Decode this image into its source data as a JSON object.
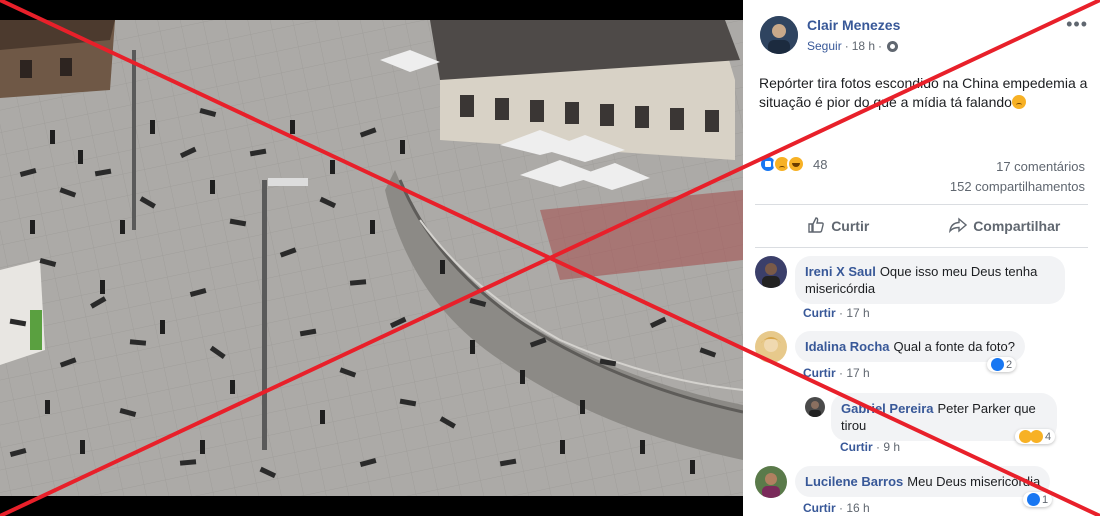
{
  "post": {
    "author": "Clair Menezes",
    "follow_label": "Seguir",
    "time": "18 h",
    "text": "Repórter tira fotos escondido na China empedemia a situação é pior do que a mídia tá falando",
    "reaction_count": "48",
    "comments_count": "17 comentários",
    "shares_count": "152 compartilhamentos",
    "like_label": "Curtir",
    "share_label": "Compartilhar"
  },
  "comments": [
    {
      "name": "Ireni X Saul",
      "text": "Oque isso meu Deus tenha misericórdia",
      "like_label": "Curtir",
      "time": "17 h",
      "reactions": ""
    },
    {
      "name": "Idalina Rocha",
      "text": "Qual a fonte da foto?",
      "like_label": "Curtir",
      "time": "17 h",
      "reactions": "2"
    },
    {
      "name": "Gabriel Pereira",
      "text": "Peter Parker que tirou",
      "like_label": "Curtir",
      "time": "9 h",
      "reactions": "4"
    },
    {
      "name": "Lucilene Barros",
      "text": "Meu Deus misericórdia",
      "like_label": "Curtir",
      "time": "16 h",
      "reactions": "1"
    }
  ],
  "colors": {
    "link_blue": "#385898",
    "overlay_red": "#e8202a",
    "like_blue": "#1877f2",
    "emoji_yellow": "#f7b125"
  },
  "icons": [
    "globe-icon",
    "more-icon",
    "like-icon",
    "share-icon",
    "like-reaction-icon",
    "sad-reaction-icon",
    "haha-reaction-icon"
  ]
}
